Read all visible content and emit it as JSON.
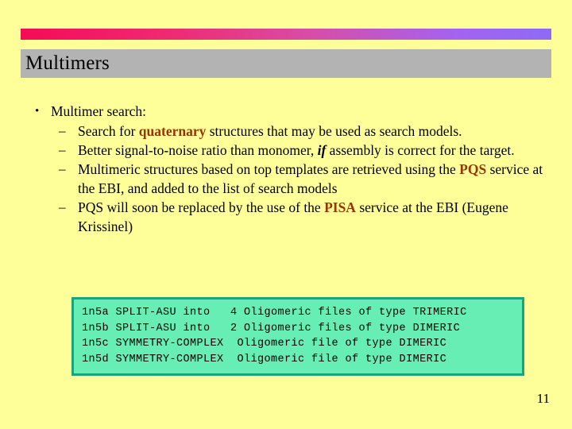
{
  "slide": {
    "background_color": "#ffff99",
    "accent_bar": {
      "gradient_start": "#f50b56",
      "gradient_end": "#8d6bf7"
    },
    "title": "Multimers",
    "title_bar_color": "#b3b3b3",
    "page_number": "11"
  },
  "bullets": {
    "level1_marker": "•",
    "level2_marker": "–",
    "top": "Multimer search:",
    "items": [
      {
        "seg1": "Search for ",
        "hl": "quaternary",
        "seg2": " structures that may be used as search models."
      },
      {
        "seg1": "Better signal-to-noise ratio than monomer, ",
        "em": "if",
        "seg2": " assembly is correct for the target."
      },
      {
        "seg1": "Multimeric structures based on top templates are retrieved using the ",
        "hl": "PQS",
        "seg2": " service at the EBI, and added to the list of search models"
      },
      {
        "seg1": "PQS will soon be replaced by the use of the ",
        "hl": "PISA",
        "seg2": " service at the EBI (Eugene Krissinel)"
      }
    ]
  },
  "code_box": {
    "background_color": "#66eeb4",
    "border_color": "#16a67a",
    "lines": [
      "1n5a SPLIT-ASU into   4 Oligomeric files of type TRIMERIC",
      "1n5b SPLIT-ASU into   2 Oligomeric files of type DIMERIC",
      "1n5c SYMMETRY-COMPLEX  Oligomeric file of type DIMERIC",
      "1n5d SYMMETRY-COMPLEX  Oligomeric file of type DIMERIC"
    ]
  }
}
